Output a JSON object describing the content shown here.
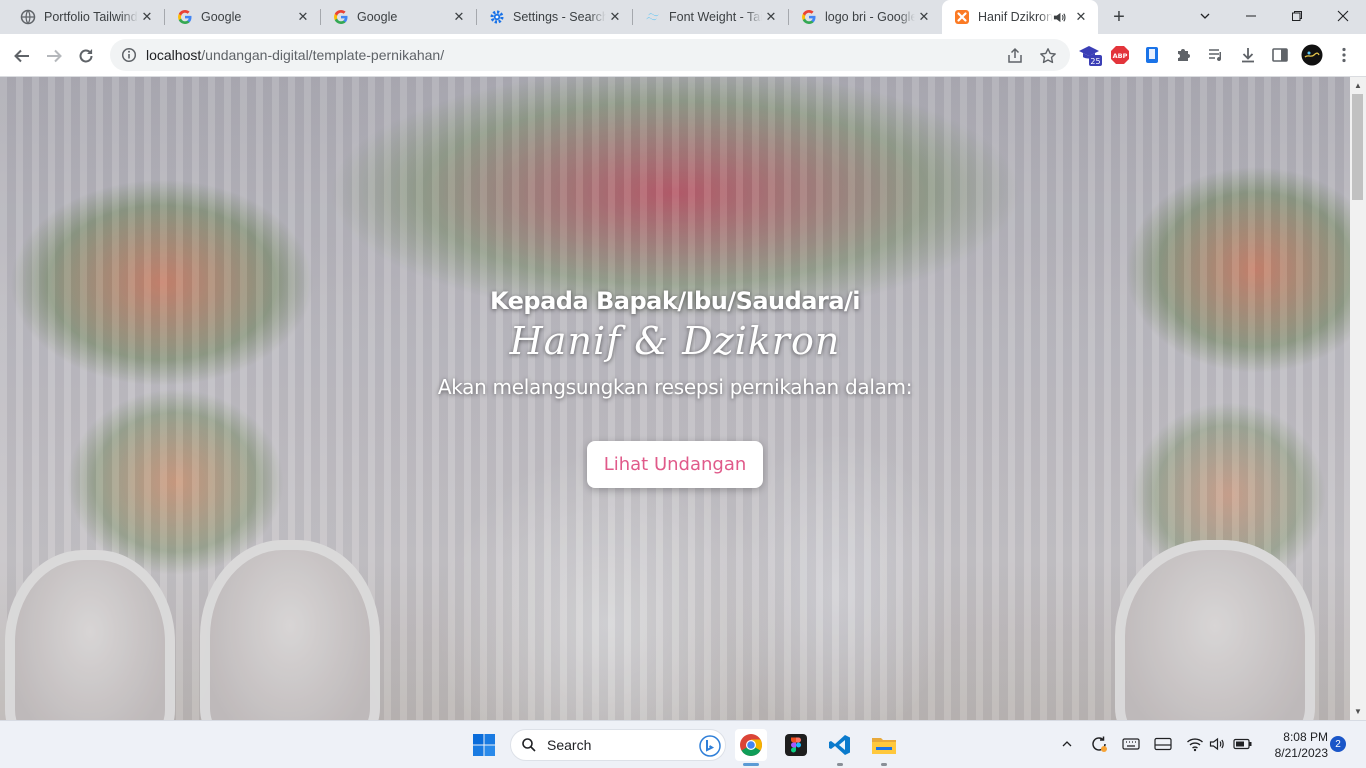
{
  "tabs": [
    {
      "title": "Portfolio Tailwind",
      "icon": "globe-icon"
    },
    {
      "title": "Google",
      "icon": "google-icon"
    },
    {
      "title": "Google",
      "icon": "google-icon"
    },
    {
      "title": "Settings - Search",
      "icon": "settings-gear-icon"
    },
    {
      "title": "Font Weight - Tai",
      "icon": "tailwind-icon"
    },
    {
      "title": "logo bri - Google",
      "icon": "google-icon"
    },
    {
      "title": "Hanif Dzikron",
      "icon": "xampp-icon",
      "active": true
    }
  ],
  "address_bar": {
    "host": "localhost",
    "path": "/undangan-digital/template-pernikahan/"
  },
  "extensions": {
    "badge_count": "25",
    "adblock_label": "ABP"
  },
  "hero": {
    "greeting": "Kepada Bapak/Ibu/Saudara/i",
    "couple_names": "Hanif & Dzikron",
    "subtitle": "Akan melangsungkan resepsi pernikahan dalam:",
    "cta_label": "Lihat Undangan"
  },
  "taskbar": {
    "search_label": "Search",
    "time": "8:08 PM",
    "date": "8/21/2023",
    "notifications": "2"
  },
  "colors": {
    "accent_pink": "#e05a8a",
    "tab_strip": "#dee1e6",
    "taskbar": "#eef1f7"
  }
}
